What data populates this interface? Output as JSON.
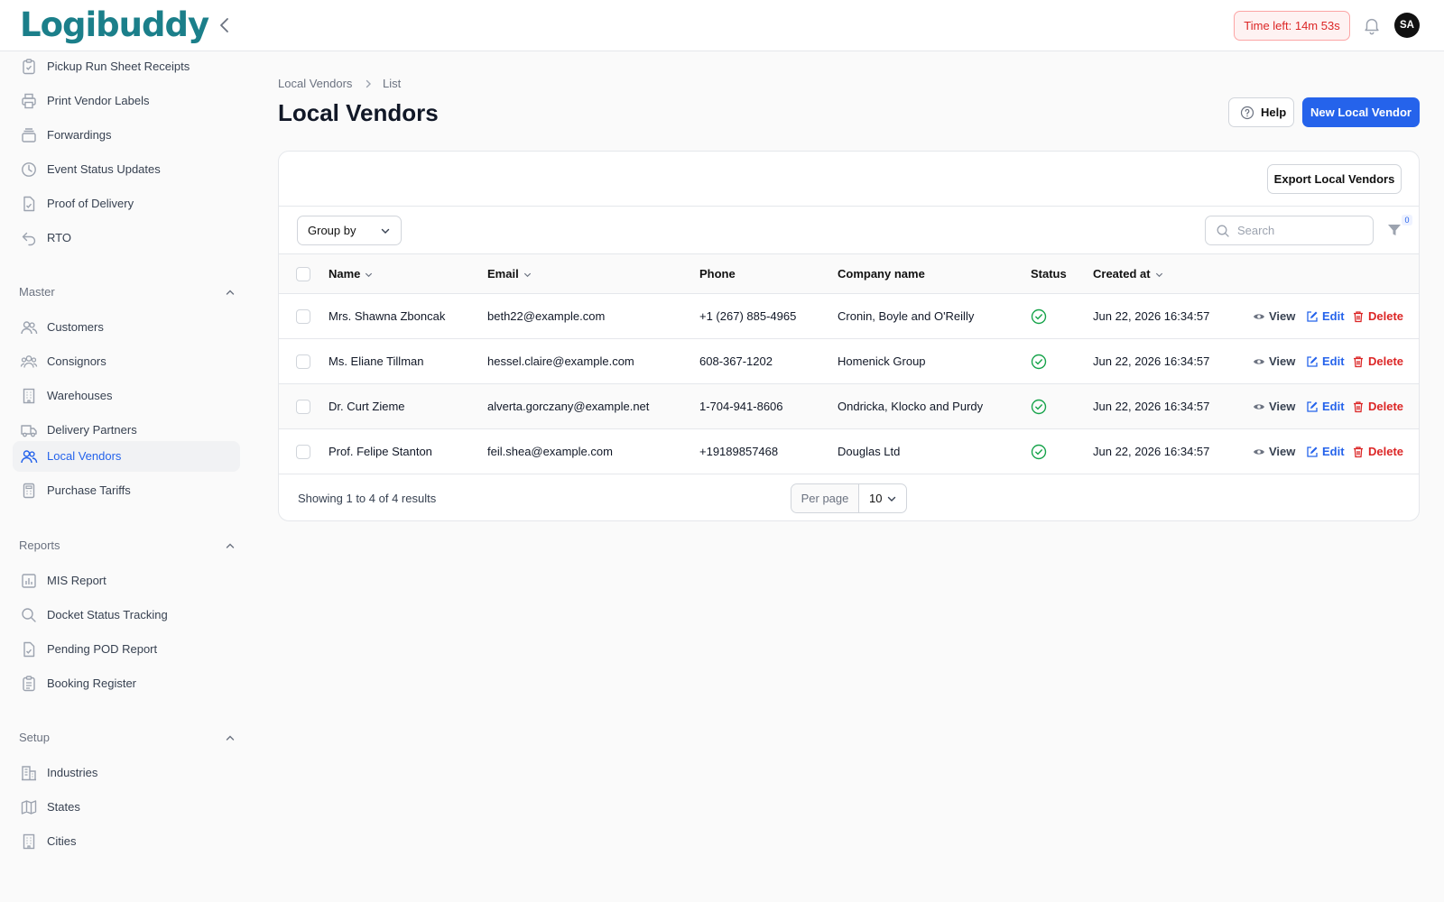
{
  "brand": {
    "name_main": "Logibudd",
    "name_tail": "y"
  },
  "header": {
    "timer": "Time left: 14m 53s",
    "avatar_initials": "SA"
  },
  "sidebar": {
    "top_items": [
      {
        "label": "Pickup Run Sheet Receipts",
        "icon": "clipboard-icon"
      },
      {
        "label": "Print Vendor Labels",
        "icon": "printer-icon"
      },
      {
        "label": "Forwardings",
        "icon": "stack-icon"
      },
      {
        "label": "Event Status Updates",
        "icon": "clock-icon"
      },
      {
        "label": "Proof of Delivery",
        "icon": "document-check-icon"
      },
      {
        "label": "RTO",
        "icon": "return-arrow-icon"
      }
    ],
    "master": {
      "title": "Master",
      "items": [
        {
          "label": "Customers",
          "icon": "users-icon"
        },
        {
          "label": "Consignors",
          "icon": "user-group-icon"
        },
        {
          "label": "Warehouses",
          "icon": "building-icon"
        },
        {
          "label": "Delivery Partners",
          "icon": "truck-icon"
        },
        {
          "label": "Local Vendors",
          "icon": "users-icon"
        },
        {
          "label": "Purchase Tariffs",
          "icon": "calculator-icon"
        }
      ]
    },
    "reports": {
      "title": "Reports",
      "items": [
        {
          "label": "MIS Report",
          "icon": "chart-bar-icon"
        },
        {
          "label": "Docket Status Tracking",
          "icon": "search-icon"
        },
        {
          "label": "Pending POD Report",
          "icon": "document-check-icon"
        },
        {
          "label": "Booking Register",
          "icon": "clipboard-list-icon"
        }
      ]
    },
    "setup": {
      "title": "Setup",
      "items": [
        {
          "label": "Industries",
          "icon": "office-building-icon"
        },
        {
          "label": "States",
          "icon": "map-icon"
        },
        {
          "label": "Cities",
          "icon": "building-icon"
        }
      ]
    }
  },
  "breadcrumb": [
    "Local Vendors",
    "List"
  ],
  "page": {
    "title": "Local Vendors",
    "help_label": "Help",
    "new_label": "New Local Vendor"
  },
  "table": {
    "export_label": "Export Local Vendors",
    "group_by_label": "Group by",
    "search_placeholder": "Search",
    "filter_count": "0",
    "columns": [
      "Name",
      "Email",
      "Phone",
      "Company name",
      "Status",
      "Created at"
    ],
    "rows": [
      {
        "name": "Mrs. Shawna Zboncak",
        "email": "beth22@example.com",
        "phone": "+1 (267) 885-4965",
        "company": "Cronin, Boyle and O'Reilly",
        "created": "Jun 22, 2026 16:34:57"
      },
      {
        "name": "Ms. Eliane Tillman",
        "email": "hessel.claire@example.com",
        "phone": "608-367-1202",
        "company": "Homenick Group",
        "created": "Jun 22, 2026 16:34:57"
      },
      {
        "name": "Dr. Curt Zieme",
        "email": "alverta.gorczany@example.net",
        "phone": "1-704-941-8606",
        "company": "Ondricka, Klocko and Purdy",
        "created": "Jun 22, 2026 16:34:57"
      },
      {
        "name": "Prof. Felipe Stanton",
        "email": "feil.shea@example.com",
        "phone": "+19189857468",
        "company": "Douglas Ltd",
        "created": "Jun 22, 2026 16:34:57"
      }
    ],
    "actions": {
      "view": "View",
      "edit": "Edit",
      "delete": "Delete"
    },
    "showing": "Showing 1 to 4 of 4 results",
    "per_page_label": "Per page",
    "per_page_value": "10"
  },
  "colors": {
    "primary": "#2563eb",
    "danger": "#dc2626",
    "success": "#16a34a",
    "brand": "#1b7f8a"
  }
}
